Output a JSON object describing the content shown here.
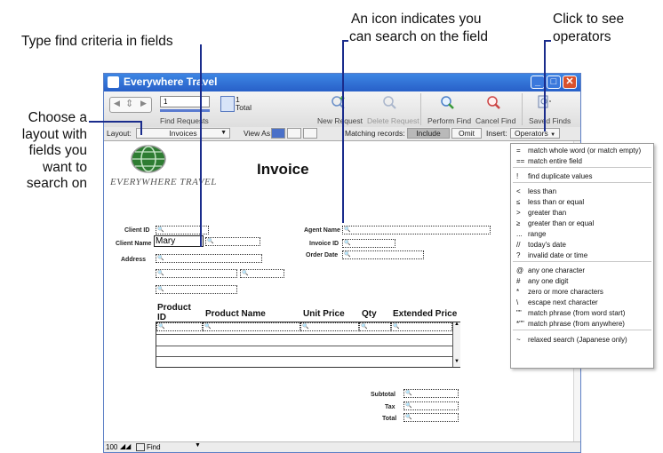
{
  "callouts": {
    "type_criteria": "Type find criteria in fields",
    "icon_line1": "An icon indicates you",
    "icon_line2": "can search on the field",
    "click_line1": "Click to see",
    "click_line2": "operators",
    "layout_line1": "Choose a",
    "layout_line2": "layout with",
    "layout_line3": "fields you",
    "layout_line4": "want to",
    "layout_line5": "search on"
  },
  "window": {
    "title": "Everywhere Travel"
  },
  "toolbar": {
    "record_number": "1",
    "total_count": "1",
    "total_label": "Total",
    "find_requests_label": "Find Requests",
    "new_request": "New Request",
    "delete_request": "Delete Request",
    "perform_find": "Perform Find",
    "cancel_find": "Cancel Find",
    "saved_finds": "Saved Finds"
  },
  "layout_bar": {
    "layout_label": "Layout:",
    "layout_value": "Invoices",
    "view_as_label": "View As:",
    "matching_label": "Matching records:",
    "include": "Include",
    "omit": "Omit",
    "insert_label": "Insert:",
    "operators": "Operators"
  },
  "form": {
    "logo_text": "EVERYWHERE TRAVEL",
    "heading": "Invoice",
    "client_id_label": "Client ID",
    "client_name_label": "Client Name",
    "client_name_value": "Mary",
    "address_label": "Address",
    "agent_name_label": "Agent Name",
    "invoice_id_label": "Invoice ID",
    "order_date_label": "Order Date",
    "col_product_id_1": "Product",
    "col_product_id_2": "ID",
    "col_product_name": "Product Name",
    "col_unit_price": "Unit Price",
    "col_qty": "Qty",
    "col_extended_price": "Extended Price",
    "subtotal_label": "Subtotal",
    "tax_label": "Tax",
    "total_label": "Total"
  },
  "operators_menu": [
    {
      "symbol": "=",
      "text": "match whole word (or match empty)"
    },
    {
      "symbol": "==",
      "text": "match entire field"
    },
    {
      "symbol": "!",
      "text": "find duplicate values"
    },
    {
      "symbol": "<",
      "text": "less than"
    },
    {
      "symbol": "≤",
      "text": "less than or equal"
    },
    {
      "symbol": ">",
      "text": "greater than"
    },
    {
      "symbol": "≥",
      "text": "greater than or equal"
    },
    {
      "symbol": "...",
      "text": "range"
    },
    {
      "symbol": "//",
      "text": "today's date"
    },
    {
      "symbol": "?",
      "text": "invalid date or time"
    },
    {
      "symbol": "@",
      "text": "any one character"
    },
    {
      "symbol": "#",
      "text": "any one digit"
    },
    {
      "symbol": "*",
      "text": "zero or more characters"
    },
    {
      "symbol": "\\",
      "text": "escape next character"
    },
    {
      "symbol": "\"\"",
      "text": "match phrase (from word start)"
    },
    {
      "symbol": "*\"\"",
      "text": "match phrase (from anywhere)"
    },
    {
      "symbol": "~",
      "text": "relaxed search (Japanese only)"
    }
  ],
  "status_bar": {
    "zoom": "100",
    "mode": "Find"
  }
}
